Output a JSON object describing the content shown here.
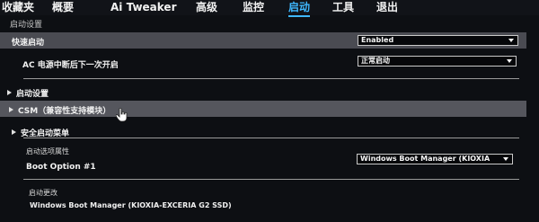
{
  "menu": {
    "tabs": [
      {
        "label": "收藏夹"
      },
      {
        "label": "概要"
      },
      {
        "label": "Ai Tweaker"
      },
      {
        "label": "高级"
      },
      {
        "label": "监控"
      },
      {
        "label": "启动"
      },
      {
        "label": "工具"
      },
      {
        "label": "退出"
      }
    ],
    "active_tab": "启动"
  },
  "page": {
    "title": "启动设置"
  },
  "settings": {
    "fast_boot": {
      "label": "快速启动",
      "value": "Enabled"
    },
    "ac_power": {
      "label": "AC 电源中断后下一次开启",
      "value": "正常启动"
    },
    "boot_config": {
      "label": "启动设置"
    },
    "csm": {
      "label": "CSM（兼容性支持模块）"
    },
    "secure_boot": {
      "label": "安全启动菜单"
    },
    "boot_option_priority": {
      "label": "启动选项属性"
    },
    "boot_option_1": {
      "label": "Boot Option #1",
      "value": "Windows Boot Manager (KIOXIA"
    },
    "boot_override": {
      "label": "启动更改",
      "items": [
        {
          "label": "Windows Boot Manager (KIOXIA-EXCERIA G2 SSD)"
        }
      ]
    }
  },
  "colors": {
    "accent": "#3fb8ff",
    "highlight_row": "#4a4b52",
    "background": "#0d0f13"
  }
}
